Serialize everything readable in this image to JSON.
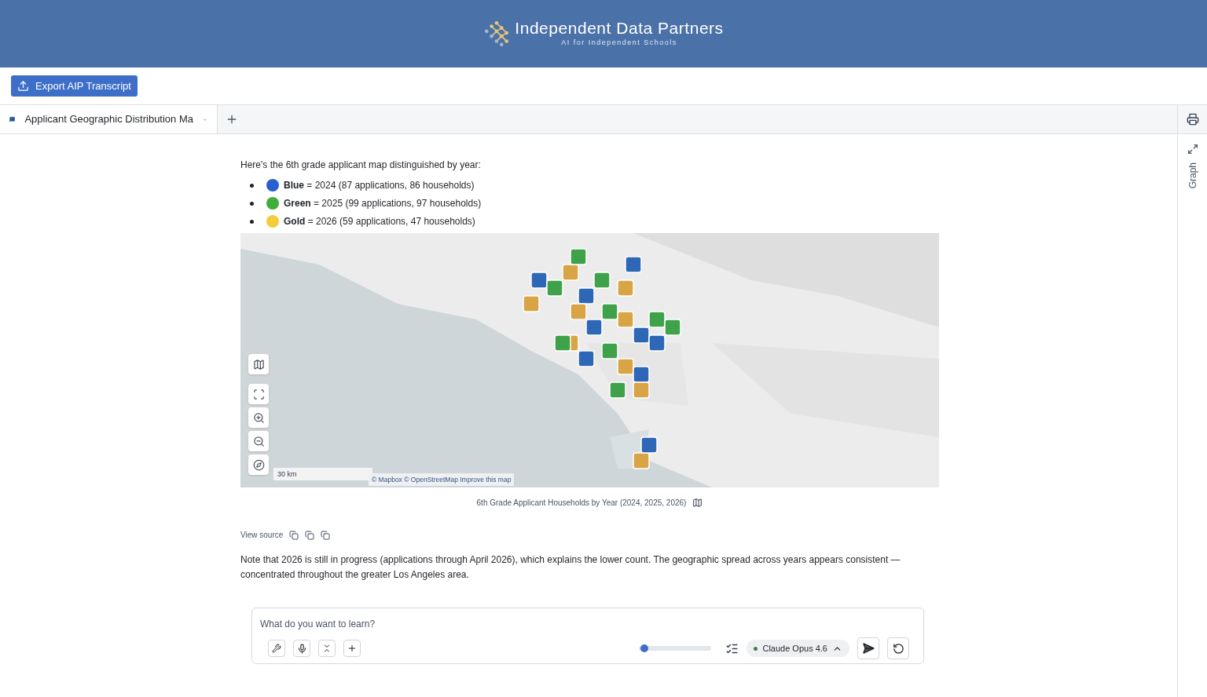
{
  "header": {
    "title": "Independent Data Partners",
    "subtitle": "AI for Independent Schools"
  },
  "export_button": {
    "label": "Export AIP Transcript"
  },
  "tabs": [
    {
      "label": "Applicant Geographic Distribution Ma",
      "selected": true
    }
  ],
  "side_panel": {
    "label": "Graph"
  },
  "message": {
    "intro": "Here's the 6th grade applicant map distinguished by year:",
    "legend": [
      {
        "text": "**Blue** = 2024 (87 applications, 86 households)",
        "color": "#2a5fd0"
      },
      {
        "text": "**Green** = 2025 (99 applications, 97 households)",
        "color": "#3fae3a"
      },
      {
        "text": "**Gold** = 2026 (59 applications, 47 households)",
        "color": "#f4cd3a"
      }
    ],
    "map": {
      "scale": "30 km",
      "attribution": "© Mapbox © OpenStreetMap Improve this map",
      "caption": "6th Grade Applicant Households by Year (2024, 2025, 2026)"
    },
    "view_source": "View source",
    "note": "Note that 2026 is still in progress (applications through April 2026), which explains the lower count. The geographic spread across years appears consistent — concentrated throughout the greater Los Angeles area."
  },
  "composer": {
    "placeholder": "What do you want to learn?",
    "slider": {
      "level": 0.05
    },
    "model": "Claude Opus 4.6"
  }
}
